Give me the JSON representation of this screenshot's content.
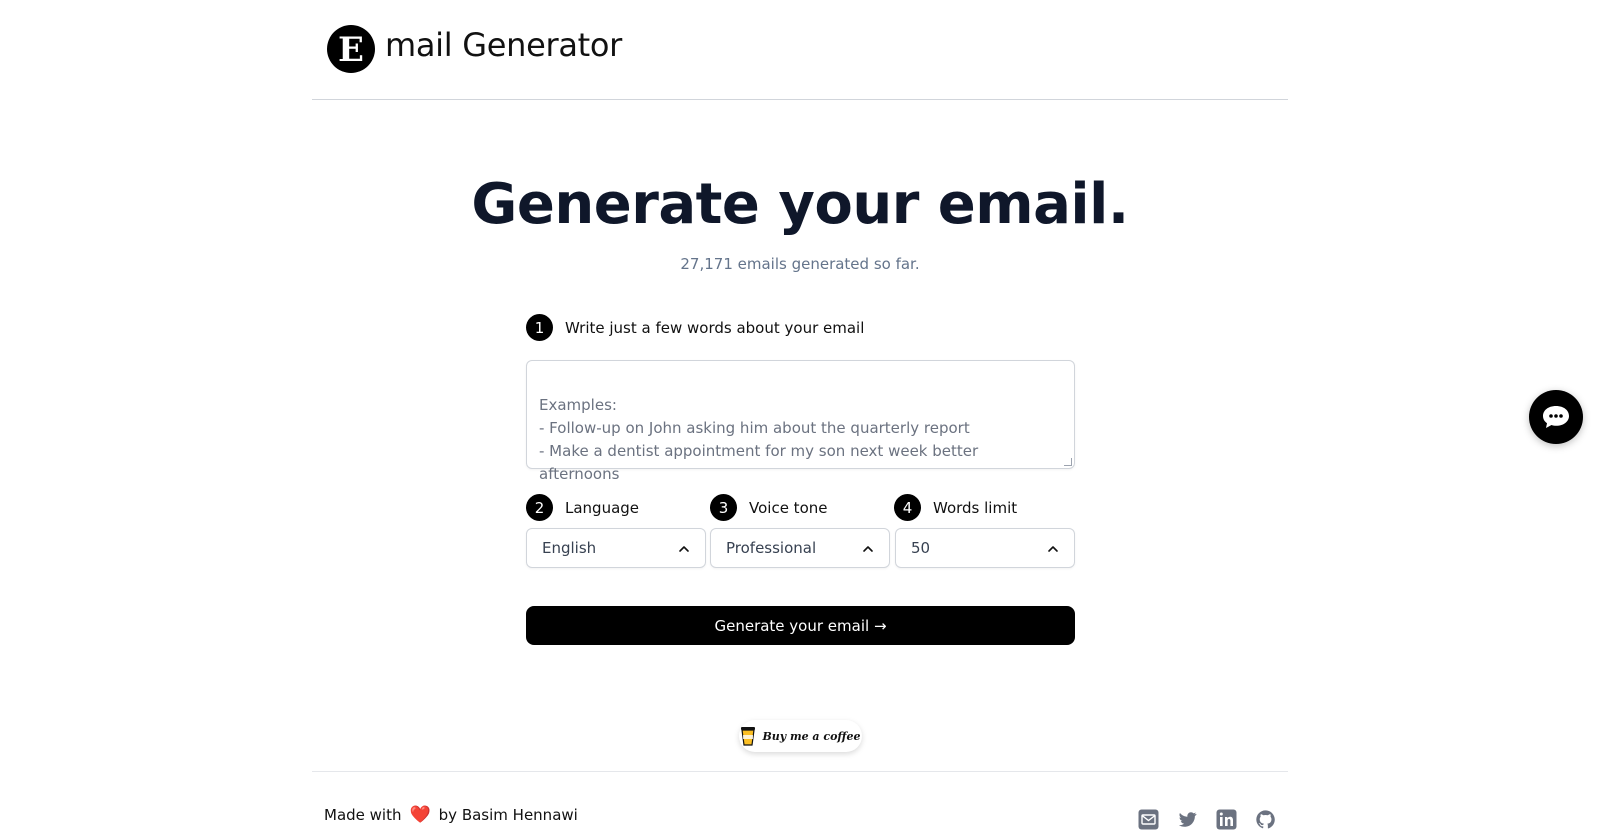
{
  "header": {
    "logo_letter": "E",
    "brand_text": "mail Generator"
  },
  "hero": {
    "title": "Generate your email.",
    "counter": "27,171 emails generated so far."
  },
  "steps": {
    "one": {
      "number": "1",
      "label": "Write just a few words about your email"
    },
    "two": {
      "number": "2",
      "label": "Language"
    },
    "three": {
      "number": "3",
      "label": "Voice tone"
    },
    "four": {
      "number": "4",
      "label": "Words limit"
    }
  },
  "prompt": {
    "placeholder": "Examples:\n- Follow-up on John asking him about the quarterly report\n- Make a dentist appointment for my son next week better afternoons"
  },
  "selects": {
    "language": "English",
    "tone": "Professional",
    "words": "50"
  },
  "generate_button": "Generate your email →",
  "coffee_label": "Buy me a coffee",
  "footer": {
    "made_with": "Made with",
    "heart": "❤️",
    "by": "by Basim Hennawi",
    "social_icons": [
      "mail-icon",
      "twitter-icon",
      "linkedin-icon",
      "github-icon"
    ]
  },
  "colors": {
    "accent": "#000000",
    "title": "#0f172a",
    "muted": "#64748b",
    "border": "#d1d5db",
    "social": "#6b7280"
  }
}
